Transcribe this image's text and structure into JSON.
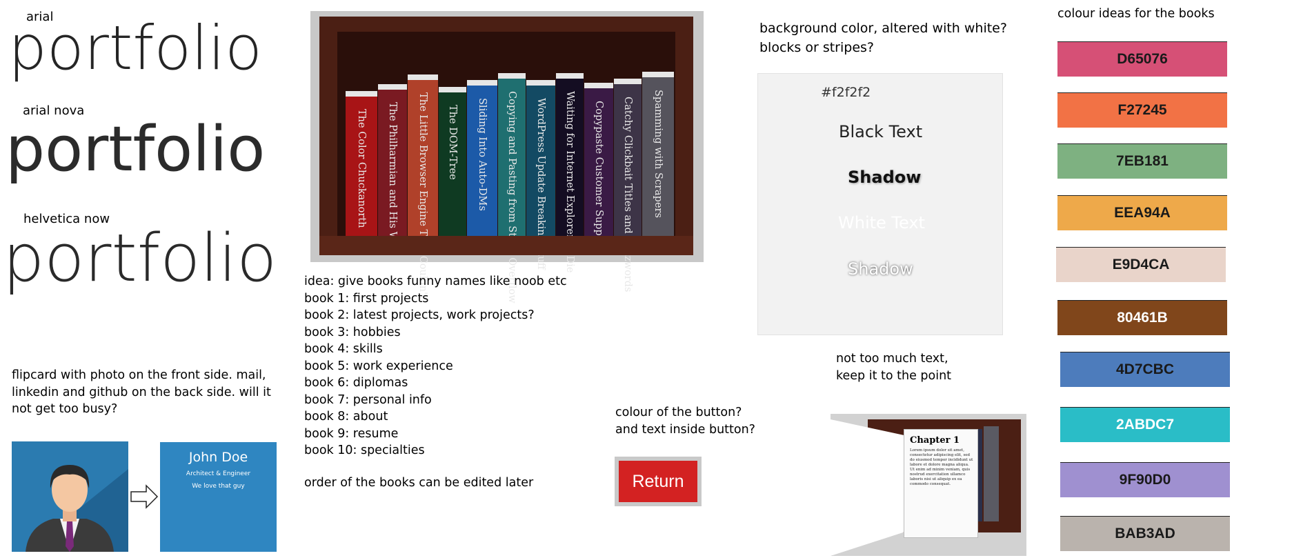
{
  "fonts": {
    "arial_label": "arial",
    "arial_nova_label": "arial nova",
    "helvetica_label": "helvetica now",
    "sample_word": "portfolio"
  },
  "flipcard": {
    "note_lines": [
      "flipcard with photo on the front side. mail,",
      "linkedin and github on the back side. will it",
      "not get too busy?"
    ],
    "back_name": "John Doe",
    "back_title": "Architect & Engineer",
    "back_tagline": "We love that guy"
  },
  "bookshelf": {
    "books": [
      {
        "title": "The Color Chuckanorth",
        "color": "#a81416"
      },
      {
        "title": "The Philharmian and His Wife",
        "color": "#7a1a22"
      },
      {
        "title": "The Little Browser Engine That Couldn't",
        "color": "#b0412a"
      },
      {
        "title": "The DOM-Tree",
        "color": "#0f3a22"
      },
      {
        "title": "Sliding Into Auto-DMs",
        "color": "#1c5aa8"
      },
      {
        "title": "Copying and Pasting from Stack Overflow",
        "color": "#1f6f70"
      },
      {
        "title": "WordPress Update Breaking Stuff",
        "color": "#134a63"
      },
      {
        "title": "Waiting for Internet Explorer to Die",
        "color": "#140d22"
      },
      {
        "title": "Copypaste Customer Support",
        "color": "#3a1a45"
      },
      {
        "title": "Catchy Clickbait Titles and Buzzwords",
        "color": "#3d3447"
      },
      {
        "title": "Spamming with Scrapers",
        "color": "#55535c"
      }
    ]
  },
  "book_ideas": {
    "lines": [
      "idea: give books funny names like noob etc",
      "book 1: first projects",
      "book 2: latest projects, work projects?",
      "book 3: hobbies",
      "book 4: skills",
      "book 5: work experience",
      "book 6: diplomas",
      "book 7: personal info",
      "book 8: about",
      "book 9: resume",
      "book 10: specialties"
    ],
    "order_note": "order of the books can be edited later"
  },
  "background_question": [
    "background color, altered with white?",
    "blocks or stripes?"
  ],
  "text_test": {
    "hex": "#f2f2f2",
    "black_text": "Black Text",
    "black_shadow": "Shadow",
    "white_text": "White Text",
    "white_shadow": "Shadow"
  },
  "text_note": [
    "not too much text,",
    "keep it to the point"
  ],
  "button_question": [
    "colour of the button?",
    "and text inside button?"
  ],
  "return_button": {
    "label": "Return",
    "color": "#d32222"
  },
  "chapter_preview": {
    "heading": "Chapter 1",
    "body": "Lorem ipsum dolor sit amet, consectetur adipiscing elit, sed do eiusmod tempor incididunt ut labore et dolore magna aliqua. Ut enim ad minim veniam, quis nostrud exercitation ullamco laboris nisi ut aliquip ex ea commodo consequat."
  },
  "colour_ideas": {
    "title": "colour ideas for the books",
    "swatches": [
      {
        "hex": "D65076",
        "color": "#D65076",
        "text_color": "#1a1a1a"
      },
      {
        "hex": "F27245",
        "color": "#F27245",
        "text_color": "#1a1a1a"
      },
      {
        "hex": "7EB181",
        "color": "#7EB181",
        "text_color": "#1a1a1a"
      },
      {
        "hex": "EEA94A",
        "color": "#EEA94A",
        "text_color": "#1a1a1a"
      },
      {
        "hex": "E9D4CA",
        "color": "#E9D4CA",
        "text_color": "#1a1a1a"
      },
      {
        "hex": "80461B",
        "color": "#80461B",
        "text_color": "#ffffff"
      },
      {
        "hex": "4D7CBC",
        "color": "#4D7CBC",
        "text_color": "#1a1a1a"
      },
      {
        "hex": "2ABDC7",
        "color": "#2ABDC7",
        "text_color": "#ffffff"
      },
      {
        "hex": "9F90D0",
        "color": "#9F90D0",
        "text_color": "#1a1a1a"
      },
      {
        "hex": "BAB3AD",
        "color": "#BAB3AD",
        "text_color": "#1a1a1a"
      }
    ]
  }
}
